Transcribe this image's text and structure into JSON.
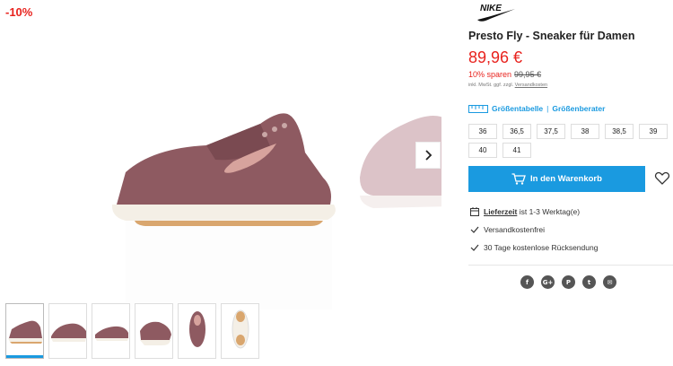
{
  "badge": {
    "discount": "-10%"
  },
  "product": {
    "brand_logo": "nike-swoosh-icon",
    "title": "Presto Fly - Sneaker für Damen",
    "price": "89,96 €",
    "saving_label": "10% sparen",
    "old_price": "99,95 €",
    "vat_prefix": "inkl. MwSt. ggf. zzgl.",
    "vat_link": "Versandkosten"
  },
  "sizes": {
    "table_label": "Größentabelle",
    "separator": "|",
    "advisor_label": "Größenberater",
    "options": [
      "36",
      "36,5",
      "37,5",
      "38",
      "38,5",
      "39",
      "40",
      "41"
    ]
  },
  "cart": {
    "button_label": "In den Warenkorb"
  },
  "info": {
    "delivery_label": "Lieferzeit",
    "delivery_text": "ist 1-3 Werktag(e)",
    "free_shipping": "Versandkostenfrei",
    "returns": "30 Tage kostenlose Rücksendung"
  },
  "social": {
    "icons": [
      "facebook-icon",
      "google-plus-icon",
      "pinterest-icon",
      "twitter-icon",
      "email-icon"
    ],
    "labels": [
      "f",
      "G+",
      "P",
      "t",
      "✉"
    ]
  },
  "gallery": {
    "thumbnail_count": 6,
    "active_index": 0
  },
  "colors": {
    "accent": "#1a9ae0",
    "sale": "#e8231e",
    "shoe": "#8e5a61",
    "sole": "#f4efe6"
  }
}
